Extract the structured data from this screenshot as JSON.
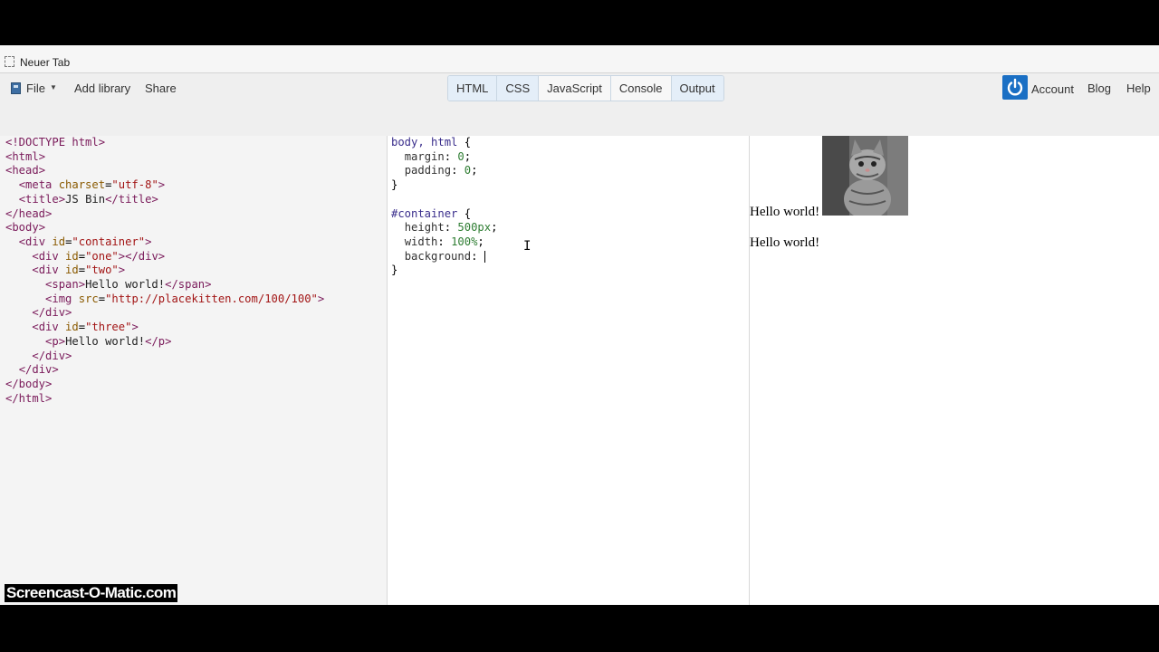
{
  "browser": {
    "tab_title": "Neuer Tab"
  },
  "toolbar": {
    "file_label": "File",
    "add_library_label": "Add library",
    "share_label": "Share",
    "panels": [
      "HTML",
      "CSS",
      "JavaScript",
      "Console",
      "Output"
    ],
    "account_label": "Account",
    "blog_label": "Blog",
    "help_label": "Help",
    "accent_color": "#1a6fc4"
  },
  "html_editor": {
    "lines": [
      "<!DOCTYPE html>",
      "<html>",
      "<head>",
      "  <meta charset=\"utf-8\">",
      "  <title>JS Bin</title>",
      "</head>",
      "<body>",
      "  <div id=\"container\">",
      "    <div id=\"one\"></div>",
      "    <div id=\"two\">",
      "      <span>Hello world!</span>",
      "      <img src=\"http://placekitten.com/100/100\">",
      "    </div>",
      "    <div id=\"three\">",
      "      <p>Hello world!</p>",
      "    </div>",
      "  </div>",
      "</body>",
      "</html>"
    ]
  },
  "css_editor": {
    "lines": [
      "body, html {",
      "  margin: 0;",
      "  padding: 0;",
      "}",
      "",
      "#container {",
      "  height: 500px;",
      "  width: 100%;",
      "  background: ",
      "}"
    ]
  },
  "output": {
    "span_text": "Hello world!",
    "p_text": "Hello world!"
  },
  "watermark": "Screencast-O-Matic.com"
}
